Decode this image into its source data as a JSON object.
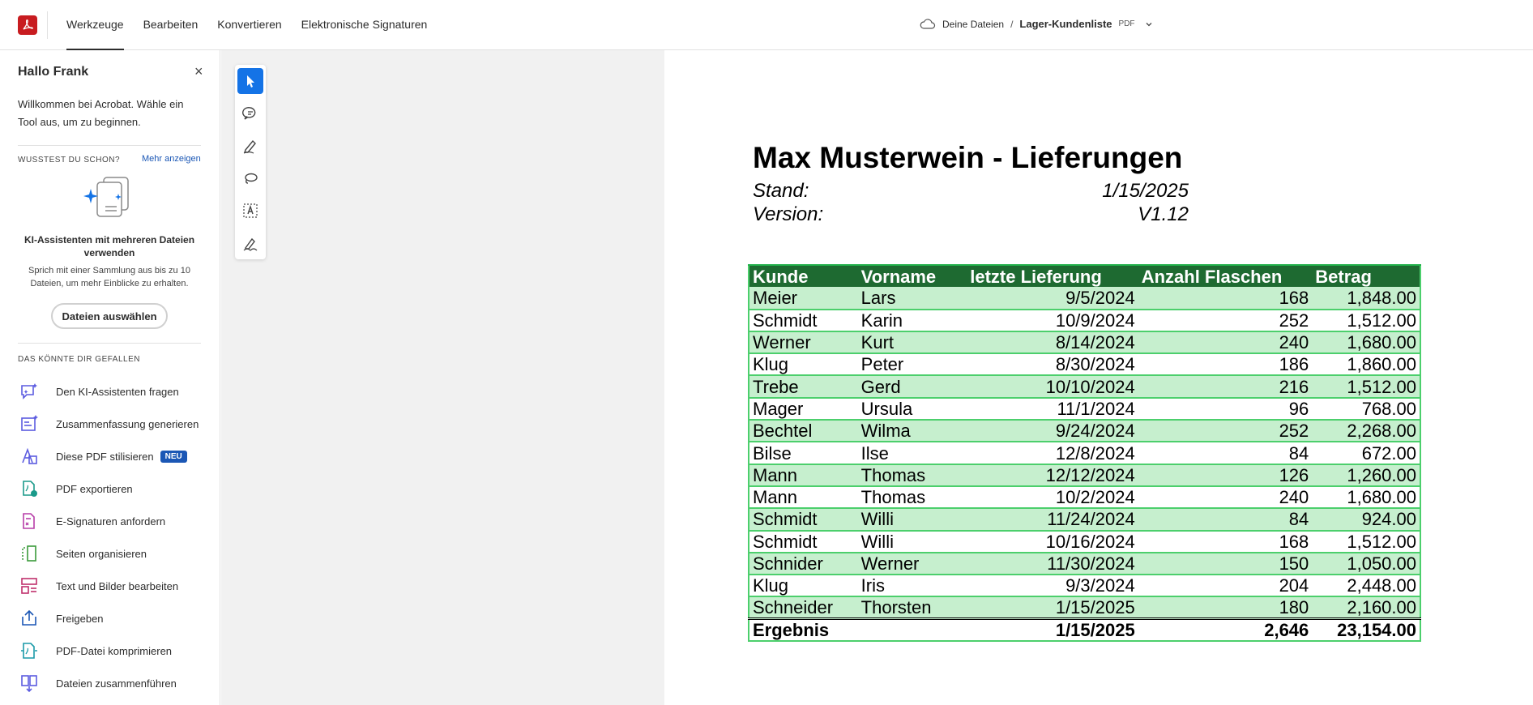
{
  "topbar": {
    "nav": [
      "Werkzeuge",
      "Bearbeiten",
      "Konvertieren",
      "Elektronische Signaturen"
    ],
    "crumb_location": "Deine Dateien",
    "crumb_sep": "/",
    "document_name": "Lager-Kundenliste",
    "file_type": "PDF"
  },
  "leftpanel": {
    "greeting": "Hallo Frank",
    "close": "×",
    "welcome": "Willkommen bei Acrobat. Wähle ein Tool aus, um zu beginnen.",
    "tip_heading": "WUSSTEST DU SCHON?",
    "tip_more": "Mehr anzeigen",
    "tip_title": "KI-Assistenten mit mehreren Dateien verwenden",
    "tip_text": "Sprich mit einer Sammlung aus bis zu 10 Dateien, um mehr Einblicke zu erhalten.",
    "tip_button": "Dateien auswählen",
    "like_heading": "DAS KÖNNTE DIR GEFALLEN",
    "tools": [
      {
        "label": "Den KI-Assistenten fragen",
        "icon": "ai-chat-icon",
        "color": "#5c5ce0"
      },
      {
        "label": "Zusammenfassung generieren",
        "icon": "ai-summary-icon",
        "color": "#5c5ce0"
      },
      {
        "label": "Diese PDF stilisieren",
        "icon": "stylize-icon",
        "color": "#5c5ce0",
        "badge": "NEU"
      },
      {
        "label": "PDF exportieren",
        "icon": "export-pdf-icon",
        "color": "#1a9a8a"
      },
      {
        "label": "E-Signaturen anfordern",
        "icon": "esign-icon",
        "color": "#b73ea8"
      },
      {
        "label": "Seiten organisieren",
        "icon": "organize-pages-icon",
        "color": "#3a9a3a"
      },
      {
        "label": "Text und Bilder bearbeiten",
        "icon": "edit-text-images-icon",
        "color": "#c0306c"
      },
      {
        "label": "Freigeben",
        "icon": "share-icon",
        "color": "#1b57b5"
      },
      {
        "label": "PDF-Datei komprimieren",
        "icon": "compress-icon",
        "color": "#1a9aa8"
      },
      {
        "label": "Dateien zusammenführen",
        "icon": "merge-files-icon",
        "color": "#5c5ce0"
      }
    ]
  },
  "vtools": [
    "select-icon",
    "comment-icon",
    "draw-icon",
    "lasso-icon",
    "text-select-icon",
    "sign-icon"
  ],
  "document": {
    "title": "Max Musterwein - Lieferungen",
    "stand_label": "Stand:",
    "stand_value": "1/15/2025",
    "version_label": "Version:",
    "version_value": "V1.12",
    "headers": [
      "Kunde",
      "Vorname",
      "letzte Lieferung",
      "Anzahl Flaschen",
      "Betrag"
    ],
    "rows": [
      [
        "Meier",
        "Lars",
        "9/5/2024",
        "168",
        "1,848.00"
      ],
      [
        "Schmidt",
        "Karin",
        "10/9/2024",
        "252",
        "1,512.00"
      ],
      [
        "Werner",
        "Kurt",
        "8/14/2024",
        "240",
        "1,680.00"
      ],
      [
        "Klug",
        "Peter",
        "8/30/2024",
        "186",
        "1,860.00"
      ],
      [
        "Trebe",
        "Gerd",
        "10/10/2024",
        "216",
        "1,512.00"
      ],
      [
        "Mager",
        "Ursula",
        "11/1/2024",
        "96",
        "768.00"
      ],
      [
        "Bechtel",
        "Wilma",
        "9/24/2024",
        "252",
        "2,268.00"
      ],
      [
        "Bilse",
        "Ilse",
        "12/8/2024",
        "84",
        "672.00"
      ],
      [
        "Mann",
        "Thomas",
        "12/12/2024",
        "126",
        "1,260.00"
      ],
      [
        "Mann",
        "Thomas",
        "10/2/2024",
        "240",
        "1,680.00"
      ],
      [
        "Schmidt",
        "Willi",
        "11/24/2024",
        "84",
        "924.00"
      ],
      [
        "Schmidt",
        "Willi",
        "10/16/2024",
        "168",
        "1,512.00"
      ],
      [
        "Schnider",
        "Werner",
        "11/30/2024",
        "150",
        "1,050.00"
      ],
      [
        "Klug",
        "Iris",
        "9/3/2024",
        "204",
        "2,448.00"
      ],
      [
        "Schneider",
        "Thorsten",
        "1/15/2025",
        "180",
        "2,160.00"
      ]
    ],
    "total": [
      "Ergebnis",
      "",
      "1/15/2025",
      "2,646",
      "23,154.00"
    ]
  }
}
